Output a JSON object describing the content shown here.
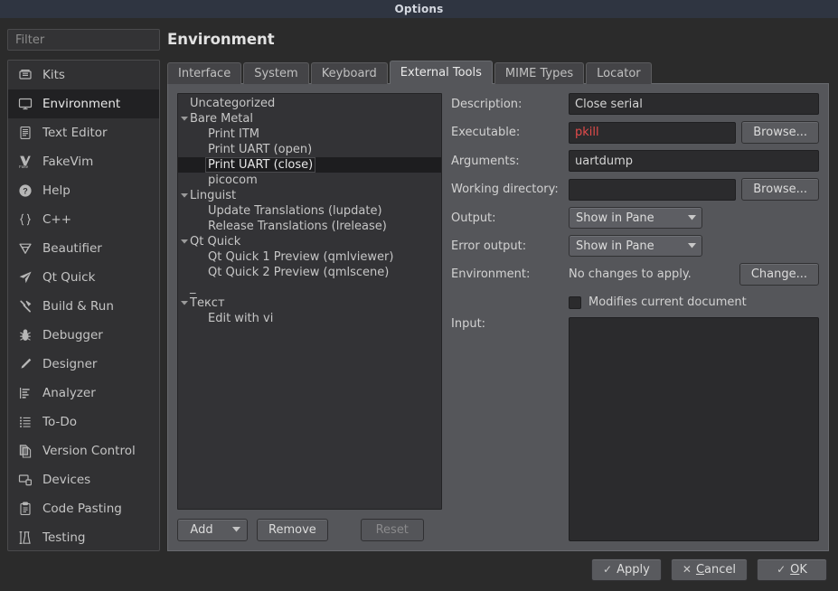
{
  "window": {
    "title": "Options"
  },
  "sidebar": {
    "filter_placeholder": "Filter",
    "items": [
      {
        "label": "Kits",
        "icon": "kits-icon"
      },
      {
        "label": "Environment",
        "icon": "monitor-icon"
      },
      {
        "label": "Text Editor",
        "icon": "document-lines-icon"
      },
      {
        "label": "FakeVim",
        "icon": "fakevim-icon"
      },
      {
        "label": "Help",
        "icon": "question-circle-icon"
      },
      {
        "label": "C++",
        "icon": "curly-braces-icon"
      },
      {
        "label": "Beautifier",
        "icon": "gem-icon"
      },
      {
        "label": "Qt Quick",
        "icon": "paper-plane-icon"
      },
      {
        "label": "Build & Run",
        "icon": "hammer-icon"
      },
      {
        "label": "Debugger",
        "icon": "bug-icon"
      },
      {
        "label": "Designer",
        "icon": "pencil-icon"
      },
      {
        "label": "Analyzer",
        "icon": "chart-bars-icon"
      },
      {
        "label": "To-Do",
        "icon": "checklist-icon"
      },
      {
        "label": "Version Control",
        "icon": "copy-pages-icon"
      },
      {
        "label": "Devices",
        "icon": "devices-icon"
      },
      {
        "label": "Code Pasting",
        "icon": "clipboard-icon"
      },
      {
        "label": "Testing",
        "icon": "flask-icon"
      }
    ],
    "selected": "Environment"
  },
  "page": {
    "title": "Environment",
    "tabs": [
      {
        "label": "Interface",
        "active": false
      },
      {
        "label": "System",
        "active": false
      },
      {
        "label": "Keyboard",
        "active": false
      },
      {
        "label": "External Tools",
        "active": true
      },
      {
        "label": "MIME Types",
        "active": false
      },
      {
        "label": "Locator",
        "active": false
      }
    ]
  },
  "tool_tree": {
    "rows": [
      {
        "label": "Uncategorized",
        "level": 0,
        "expandable": false,
        "selected": false
      },
      {
        "label": "Bare Metal",
        "level": 0,
        "expandable": true,
        "selected": false
      },
      {
        "label": "Print ITM",
        "level": 1,
        "expandable": false,
        "selected": false
      },
      {
        "label": "Print UART (open)",
        "level": 1,
        "expandable": false,
        "selected": false
      },
      {
        "label": "Print UART (close)",
        "level": 1,
        "expandable": false,
        "selected": true
      },
      {
        "label": "picocom",
        "level": 1,
        "expandable": false,
        "selected": false
      },
      {
        "label": "Linguist",
        "level": 0,
        "expandable": true,
        "selected": false
      },
      {
        "label": "Update Translations (lupdate)",
        "level": 1,
        "expandable": false,
        "selected": false
      },
      {
        "label": "Release Translations (lrelease)",
        "level": 1,
        "expandable": false,
        "selected": false
      },
      {
        "label": "Qt Quick",
        "level": 0,
        "expandable": true,
        "selected": false
      },
      {
        "label": "Qt Quick 1 Preview (qmlviewer)",
        "level": 1,
        "expandable": false,
        "selected": false
      },
      {
        "label": "Qt Quick 2 Preview (qmlscene)",
        "level": 1,
        "expandable": false,
        "selected": false
      },
      {
        "label": "_",
        "level": 0,
        "expandable": false,
        "selected": false
      },
      {
        "label": "Текст",
        "level": 0,
        "expandable": true,
        "selected": false
      },
      {
        "label": "Edit with vi",
        "level": 1,
        "expandable": false,
        "selected": false
      }
    ],
    "buttons": {
      "add": "Add",
      "remove": "Remove",
      "reset": "Reset"
    }
  },
  "form": {
    "description_label": "Description:",
    "description_value": "Close serial",
    "executable_label": "Executable:",
    "executable_value": "pkill",
    "executable_error_color": "#e34b4b",
    "arguments_label": "Arguments:",
    "arguments_value": "uartdump",
    "working_dir_label": "Working directory:",
    "working_dir_value": "",
    "output_label": "Output:",
    "output_value": "Show in Pane",
    "error_output_label": "Error output:",
    "error_output_value": "Show in Pane",
    "environment_label": "Environment:",
    "environment_value": "No changes to apply.",
    "change_button": "Change...",
    "modifies_document_label": "Modifies current document",
    "modifies_document_checked": false,
    "input_label": "Input:",
    "input_value": "",
    "browse_button": "Browse..."
  },
  "footer": {
    "apply": "Apply",
    "cancel_pre": "",
    "cancel_mnemonic": "C",
    "cancel_post": "ancel",
    "ok_mnemonic": "O",
    "ok_post": "K",
    "check_glyph": "✓",
    "cross_glyph": "✕"
  }
}
